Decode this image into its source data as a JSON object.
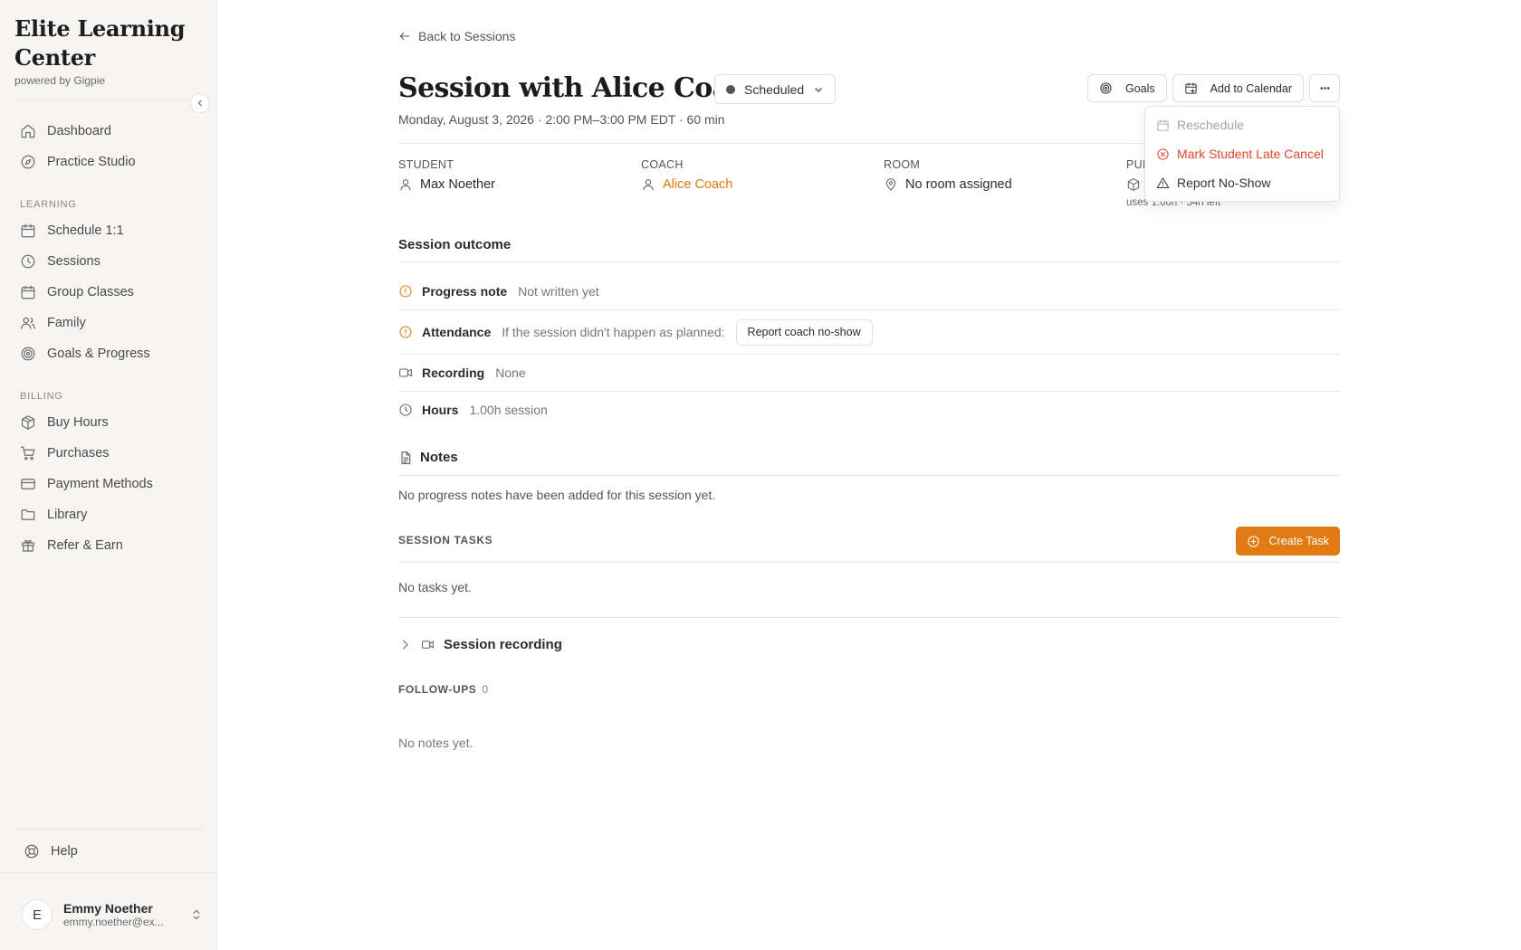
{
  "sidebar": {
    "brand_title": "Elite Learning Center",
    "brand_sub": "powered by Gigpie",
    "items_top": [
      {
        "label": "Dashboard",
        "icon": "home-icon"
      },
      {
        "label": "Practice Studio",
        "icon": "compass-icon"
      }
    ],
    "section_learning": "LEARNING",
    "items_learning": [
      {
        "label": "Schedule 1:1",
        "icon": "calendar-icon"
      },
      {
        "label": "Sessions",
        "icon": "clock-icon"
      },
      {
        "label": "Group Classes",
        "icon": "calendar-icon"
      },
      {
        "label": "Family",
        "icon": "users-icon"
      },
      {
        "label": "Goals & Progress",
        "icon": "target-icon"
      }
    ],
    "section_billing": "BILLING",
    "items_billing": [
      {
        "label": "Buy Hours",
        "icon": "package-icon"
      },
      {
        "label": "Purchases",
        "icon": "cart-icon"
      },
      {
        "label": "Payment Methods",
        "icon": "credit-card-icon"
      },
      {
        "label": "Library",
        "icon": "folder-icon"
      },
      {
        "label": "Refer & Earn",
        "icon": "gift-icon"
      }
    ],
    "help": "Help",
    "user": {
      "initial": "E",
      "name": "Emmy Noether",
      "email": "emmy.noether@ex..."
    }
  },
  "main": {
    "back": "Back to Sessions",
    "title": "Session with Alice Coach",
    "status": "Scheduled",
    "subtitle": "Monday, August 3, 2026 · 2:00 PM–3:00 PM EDT · 60 min",
    "actions": {
      "goals": "Goals",
      "calendar": "Add to Calendar"
    },
    "dropdown": {
      "reschedule": "Reschedule",
      "late_cancel": "Mark Student Late Cancel",
      "no_show": "Report No-Show"
    },
    "meta": {
      "student_label": "STUDENT",
      "student": "Max Noether",
      "coach_label": "COACH",
      "coach": "Alice Coach",
      "room_label": "ROOM",
      "room": "No room assigned",
      "purchase_label": "PUR",
      "purchase_note": "uses 1.00h · 34h left"
    },
    "outcome": {
      "title": "Session outcome",
      "progress_label": "Progress note",
      "progress_value": "Not written yet",
      "attendance_label": "Attendance",
      "attendance_value": "If the session didn't happen as planned:",
      "attendance_button": "Report coach no-show",
      "recording_label": "Recording",
      "recording_value": "None",
      "hours_label": "Hours",
      "hours_value": "1.00h session"
    },
    "notes": {
      "title": "Notes",
      "empty": "No progress notes have been added for this session yet."
    },
    "tasks": {
      "title": "SESSION TASKS",
      "button": "Create Task",
      "empty": "No tasks yet."
    },
    "recording_section": "Session recording",
    "followups": {
      "title": "FOLLOW-UPS",
      "count": "0",
      "empty": "No notes yet."
    }
  },
  "colors": {
    "accent": "#e07a12",
    "danger": "#e0472b",
    "sidebar_bg": "#f6f5f3"
  }
}
